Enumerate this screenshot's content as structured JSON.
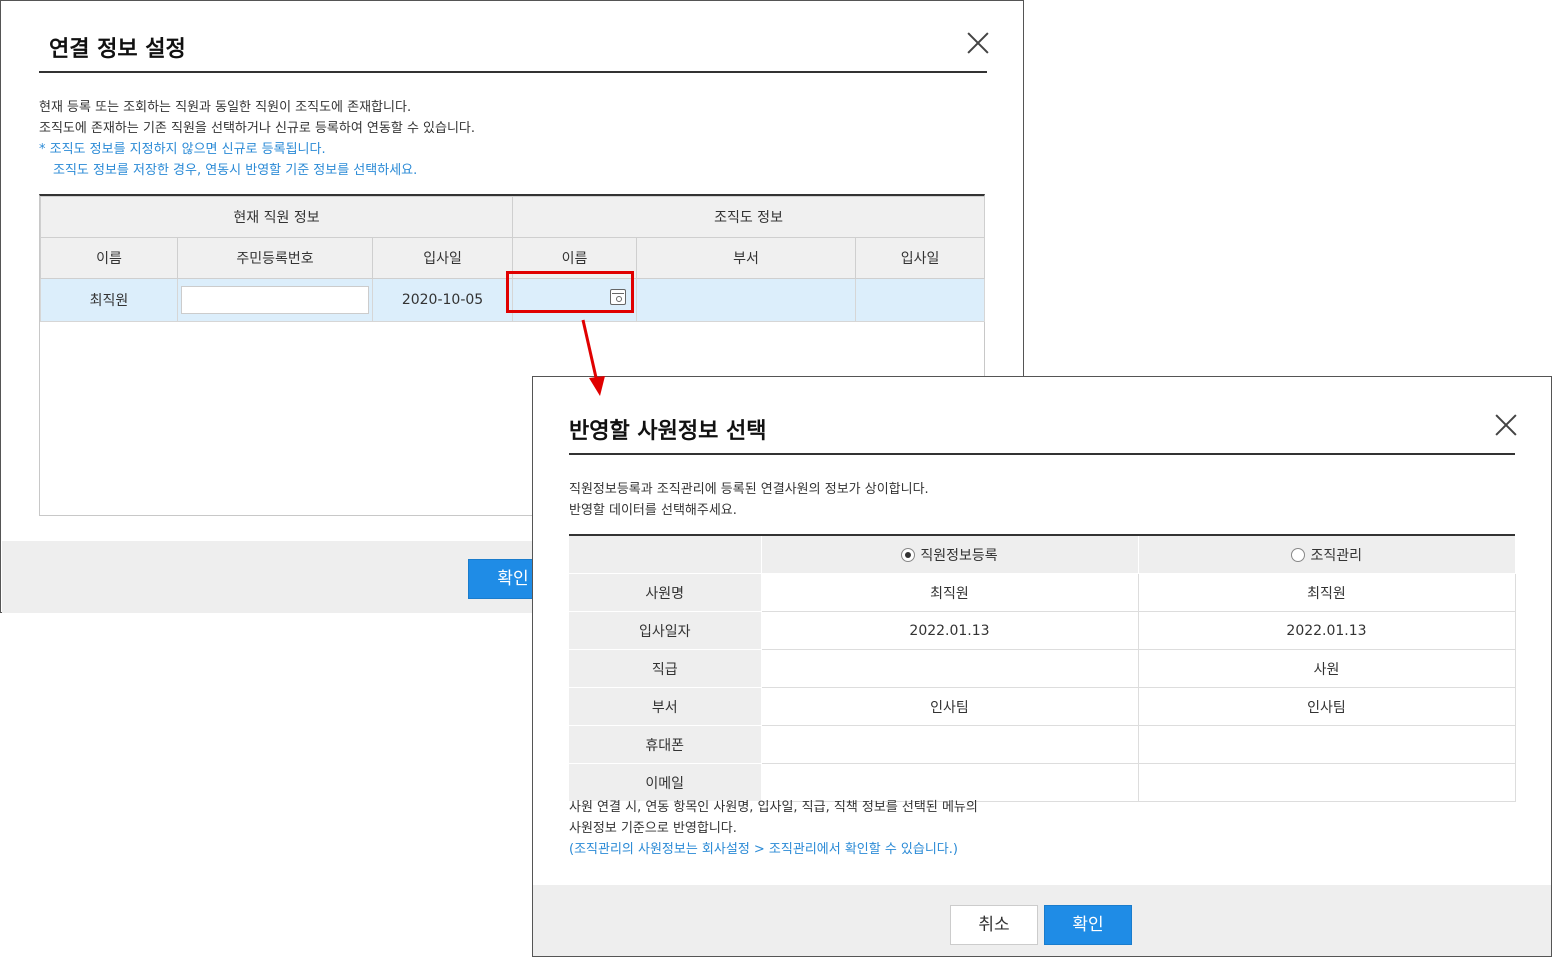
{
  "dialog1": {
    "title": "연결 정보 설정",
    "desc": [
      "현재 등록 또는 조회하는 직원과 동일한 직원이 조직도에 존재합니다.",
      "조직도에 존재하는 기존 직원을 선택하거나 신규로 등록하여 연동할 수 있습니다.",
      "* 조직도 정보를 지정하지 않으면 신규로 등록됩니다.",
      "조직도 정보를 저장한 경우, 연동시 반영할 기준 정보를 선택하세요."
    ],
    "table": {
      "group_current": "현재 직원 정보",
      "group_org": "조직도 정보",
      "headers": [
        "이름",
        "주민등록번호",
        "입사일",
        "이름",
        "부서",
        "입사일"
      ],
      "row": {
        "name": "최직원",
        "ssn": "",
        "join_date": "2020-10-05",
        "org_name": "",
        "org_dept": "",
        "org_join_date": ""
      }
    },
    "ok_label": "확인"
  },
  "dialog2": {
    "title": "반영할 사원정보 선택",
    "desc": [
      "직원정보등록과 조직관리에 등록된 연결사원의 정보가 상이합니다.",
      "반영할 데이터를 선택해주세요."
    ],
    "options": {
      "a": "직원정보등록",
      "b": "조직관리",
      "selected": "a"
    },
    "rows": [
      {
        "label": "사원명",
        "a": "최직원",
        "b": "최직원"
      },
      {
        "label": "입사일자",
        "a": "2022.01.13",
        "b": "2022.01.13"
      },
      {
        "label": "직급",
        "a": "",
        "b": "사원"
      },
      {
        "label": "부서",
        "a": "인사팀",
        "b": "인사팀"
      },
      {
        "label": "휴대폰",
        "a": "",
        "b": ""
      },
      {
        "label": "이메일",
        "a": "",
        "b": ""
      }
    ],
    "notes": [
      "사원 연결 시, 연동 항목인 사원명, 입사일, 직급, 직책 정보를 선택된 메뉴의",
      "사원정보 기준으로 반영합니다.",
      "(조직관리의 사원정보는 회사설정 > 조직관리에서 확인할 수 있습니다.)"
    ],
    "cancel_label": "취소",
    "ok_label": "확인"
  },
  "colors": {
    "primary": "#1f8ce6",
    "highlight": "#e00000",
    "info_text": "#2a8ad6",
    "selected_row": "#dceefb"
  }
}
